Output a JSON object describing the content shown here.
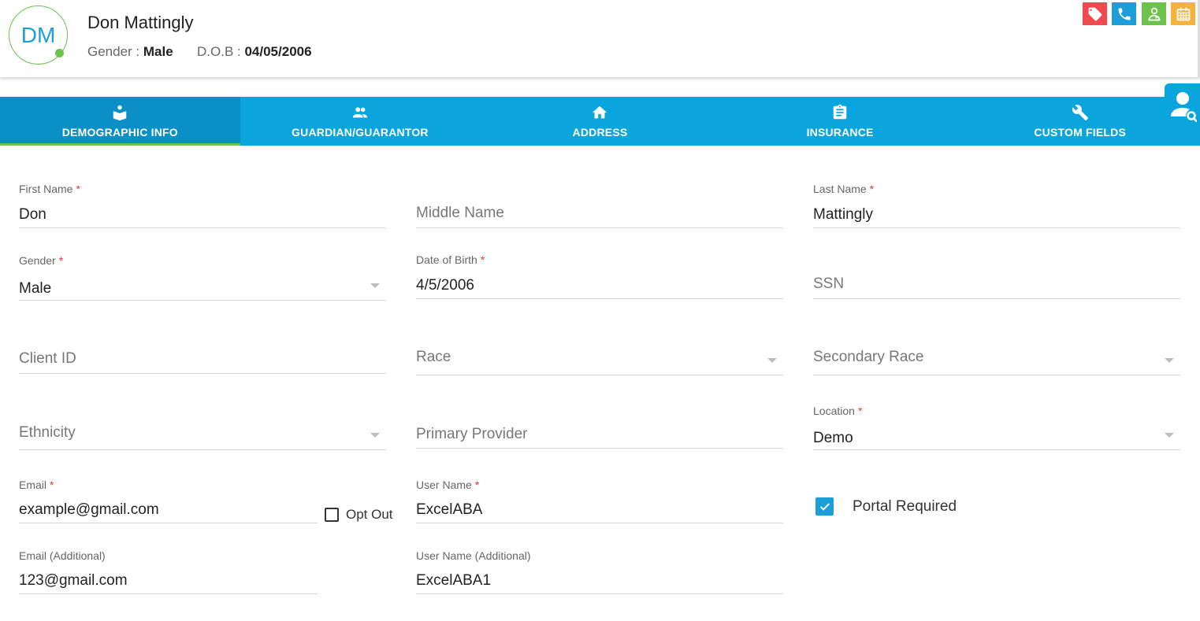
{
  "header": {
    "initials": "DM",
    "name": "Don Mattingly",
    "gender_label": "Gender :",
    "gender_value": "Male",
    "dob_label": "D.O.B :",
    "dob_value": "04/05/2006",
    "actions": [
      {
        "icon": "tag-icon",
        "color": "#f0494f"
      },
      {
        "icon": "phone-icon",
        "color": "#1a9fd8"
      },
      {
        "icon": "doctor-icon",
        "color": "#6cc24a"
      },
      {
        "icon": "calendar-icon",
        "color": "#f4b43c"
      }
    ]
  },
  "tabs": [
    {
      "label": "DEMOGRAPHIC INFO",
      "icon": "book-reader-icon",
      "active": true
    },
    {
      "label": "GUARDIAN/GUARANTOR",
      "icon": "people-icon",
      "active": false
    },
    {
      "label": "ADDRESS",
      "icon": "home-icon",
      "active": false
    },
    {
      "label": "INSURANCE",
      "icon": "clipboard-icon",
      "active": false
    },
    {
      "label": "CUSTOM FIELDS",
      "icon": "wrench-icon",
      "active": false
    }
  ],
  "form": {
    "first_name": {
      "label": "First Name",
      "required": "*",
      "value": "Don"
    },
    "middle_name": {
      "placeholder": "Middle Name"
    },
    "last_name": {
      "label": "Last Name",
      "required": "*",
      "value": "Mattingly"
    },
    "gender": {
      "label": "Gender",
      "required": "*",
      "value": "Male"
    },
    "dob": {
      "label": "Date of Birth",
      "required": "*",
      "value": "4/5/2006"
    },
    "ssn": {
      "placeholder": "SSN"
    },
    "client_id": {
      "placeholder": "Client ID"
    },
    "race": {
      "placeholder": "Race"
    },
    "secondary_race": {
      "placeholder": "Secondary Race"
    },
    "ethnicity": {
      "placeholder": "Ethnicity"
    },
    "primary_provider": {
      "placeholder": "Primary Provider"
    },
    "location": {
      "label": "Location",
      "required": "*",
      "value": "Demo"
    },
    "email": {
      "label": "Email",
      "required": "*",
      "value": "example@gmail.com"
    },
    "opt_out": {
      "label": "Opt Out",
      "checked": false
    },
    "user_name": {
      "label": "User Name",
      "required": "*",
      "value": "ExcelABA"
    },
    "portal_required": {
      "label": "Portal Required",
      "checked": true
    },
    "email_additional": {
      "label": "Email (Additional)",
      "value": "123@gmail.com"
    },
    "user_name_additional": {
      "label": "User Name (Additional)",
      "value": "ExcelABA1"
    }
  },
  "colors": {
    "accent": "#0ba5dd",
    "active_tab": "#0a8fc6",
    "green": "#6cc24a",
    "required": "#e53935"
  }
}
